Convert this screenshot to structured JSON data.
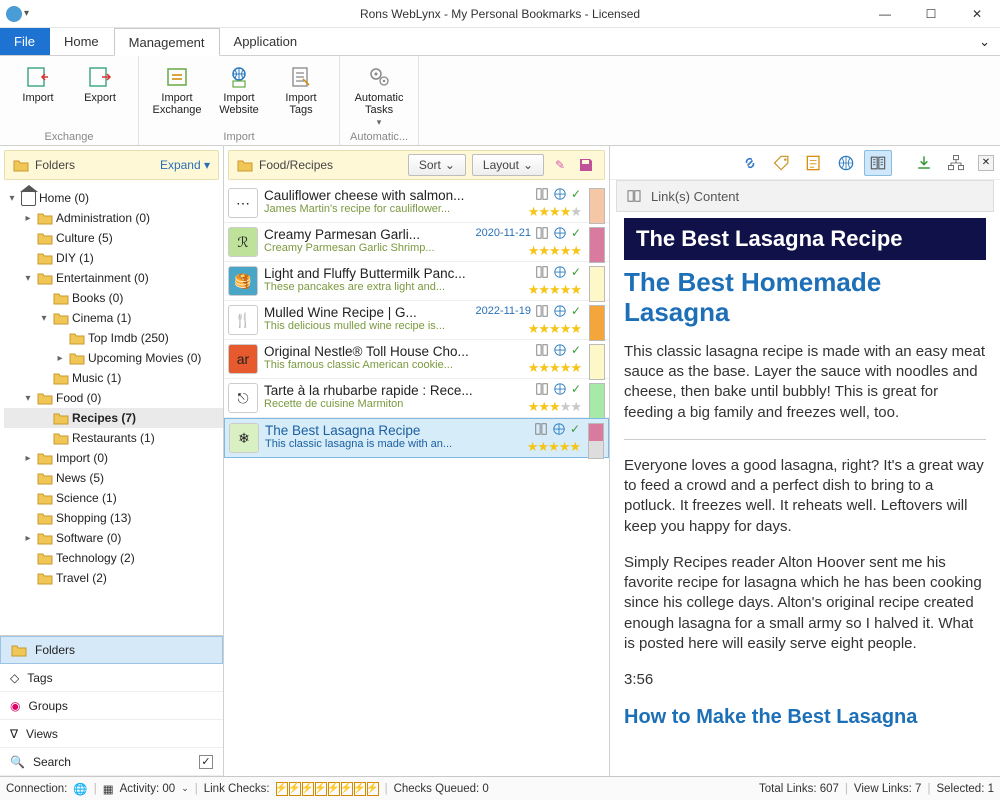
{
  "window": {
    "title": "Rons WebLynx - My Personal Bookmarks - Licensed"
  },
  "tabs": {
    "file": "File",
    "home": "Home",
    "management": "Management",
    "application": "Application"
  },
  "ribbon": {
    "exchange": {
      "import": "Import",
      "export": "Export",
      "group": "Exchange"
    },
    "import": {
      "import_exchange": "Import Exchange",
      "import_website": "Import Website",
      "import_tags": "Import Tags",
      "group": "Import"
    },
    "automatic": {
      "automatic_tasks": "Automatic Tasks",
      "group": "Automatic..."
    }
  },
  "folders": {
    "header": "Folders",
    "expand": "Expand",
    "tree": [
      {
        "d": 0,
        "tw": "▾",
        "icon": "home",
        "label": "Home (0)"
      },
      {
        "d": 1,
        "tw": "▸",
        "icon": "folder",
        "label": "Administration (0)"
      },
      {
        "d": 1,
        "tw": "",
        "icon": "folder",
        "label": "Culture (5)"
      },
      {
        "d": 1,
        "tw": "",
        "icon": "folder",
        "label": "DIY (1)"
      },
      {
        "d": 1,
        "tw": "▾",
        "icon": "folder",
        "label": "Entertainment (0)"
      },
      {
        "d": 2,
        "tw": "",
        "icon": "folder",
        "label": "Books (0)"
      },
      {
        "d": 2,
        "tw": "▾",
        "icon": "folder",
        "label": "Cinema (1)"
      },
      {
        "d": 3,
        "tw": "",
        "icon": "folder",
        "label": "Top Imdb (250)"
      },
      {
        "d": 3,
        "tw": "▸",
        "icon": "folder",
        "label": "Upcoming Movies (0)"
      },
      {
        "d": 2,
        "tw": "",
        "icon": "folder",
        "label": "Music (1)"
      },
      {
        "d": 1,
        "tw": "▾",
        "icon": "folder",
        "label": "Food (0)"
      },
      {
        "d": 2,
        "tw": "",
        "icon": "folder",
        "label": "Recipes (7)",
        "selected": true
      },
      {
        "d": 2,
        "tw": "",
        "icon": "folder",
        "label": "Restaurants (1)"
      },
      {
        "d": 1,
        "tw": "▸",
        "icon": "folder",
        "label": "Import (0)"
      },
      {
        "d": 1,
        "tw": "",
        "icon": "folder",
        "label": "News (5)"
      },
      {
        "d": 1,
        "tw": "",
        "icon": "folder",
        "label": "Science (1)"
      },
      {
        "d": 1,
        "tw": "",
        "icon": "folder",
        "label": "Shopping (13)"
      },
      {
        "d": 1,
        "tw": "▸",
        "icon": "folder",
        "label": "Software (0)"
      },
      {
        "d": 1,
        "tw": "",
        "icon": "folder",
        "label": "Technology (2)"
      },
      {
        "d": 1,
        "tw": "",
        "icon": "folder",
        "label": "Travel (2)"
      }
    ]
  },
  "leftTabs": {
    "folders": "Folders",
    "tags": "Tags",
    "groups": "Groups",
    "views": "Views",
    "search": "Search"
  },
  "mid": {
    "breadcrumb": "Food/Recipes",
    "sort": "Sort",
    "layout": "Layout",
    "items": [
      {
        "title": "Cauliflower cheese with salmon...",
        "sub": "James Martin's recipe for cauliflower...",
        "date": "",
        "stars": 4,
        "swatch": "#f6c7a6",
        "thumbBg": "#fff",
        "thumbTxt": "⋯"
      },
      {
        "title": "Creamy Parmesan Garli...",
        "sub": "Creamy Parmesan Garlic Shrimp...",
        "date": "2020-11-21",
        "stars": 5,
        "swatch": "#d87b9e",
        "thumbBg": "#bfe29b",
        "thumbTxt": "ℛ"
      },
      {
        "title": "Light and Fluffy Buttermilk Panc...",
        "sub": "These pancakes are extra light and...",
        "date": "",
        "stars": 5,
        "swatch": "#fef7c8",
        "thumbBg": "#4aa6c7",
        "thumbTxt": "🥞"
      },
      {
        "title": "Mulled Wine Recipe | G...",
        "sub": "This delicious mulled wine recipe is...",
        "date": "2022-11-19",
        "stars": 5,
        "swatch": "#f4a63a",
        "thumbBg": "#fff",
        "thumbTxt": "🍴"
      },
      {
        "title": "Original Nestle® Toll House Cho...",
        "sub": "This famous classic American cookie...",
        "date": "",
        "stars": 5,
        "swatch": "#fef7c8",
        "thumbBg": "#e65a2e",
        "thumbTxt": "ar"
      },
      {
        "title": "Tarte à la rhubarbe rapide : Rece...",
        "sub": "Recette de cuisine Marmiton",
        "date": "",
        "stars": 3,
        "swatch": "#a7eaa7",
        "thumbBg": "#fff",
        "thumbTxt": "⎋"
      },
      {
        "title": "The Best Lasagna Recipe",
        "sub": "This classic lasagna is made with an...",
        "date": "",
        "stars": 5,
        "swatch": "split",
        "thumbBg": "#d9f0c2",
        "thumbTxt": "❄",
        "selected": true
      }
    ]
  },
  "rightPanel": {
    "header": "Link(s) Content",
    "blackbar": "The Best Lasagna Recipe",
    "h1": "The Best Homemade Lasagna",
    "p1": "This classic lasagna recipe is made with an easy meat sauce as the base. Layer the sauce with noodles and cheese, then bake until bubbly! This is great for feeding a big family and freezes well, too.",
    "p2": "Everyone loves a good lasagna, right? It's a great way to feed a crowd and a perfect dish to bring to a potluck. It freezes well. It reheats well. Leftovers will keep you happy for days.",
    "p3": "Simply Recipes reader Alton Hoover sent me his favorite recipe for lasagna which he has been cooking since his college days. Alton's original recipe created enough lasagna for a small army so I halved it. What is posted here will easily serve eight people.",
    "time": "3:56",
    "h2": "How to Make the Best Lasagna"
  },
  "status": {
    "connection": "Connection:",
    "activity": "Activity: 00",
    "link_checks": "Link Checks:",
    "checks_queued": "Checks Queued: 0",
    "total": "Total Links: 607",
    "view": "View Links: 7",
    "selected": "Selected: 1"
  }
}
